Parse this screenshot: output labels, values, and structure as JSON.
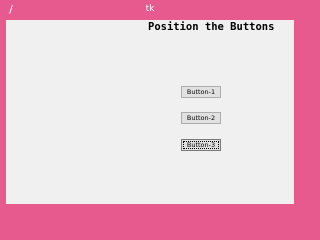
{
  "window": {
    "title": "tk",
    "icon": "feather-icon"
  },
  "main": {
    "heading": "Position the Buttons",
    "buttons": [
      {
        "label": "Button-1"
      },
      {
        "label": "Button-2"
      },
      {
        "label": "Button-3"
      }
    ]
  },
  "colors": {
    "window_frame": "#e75a8e",
    "client_background": "#f0f0f0",
    "button_face": "#e1e1e1"
  }
}
